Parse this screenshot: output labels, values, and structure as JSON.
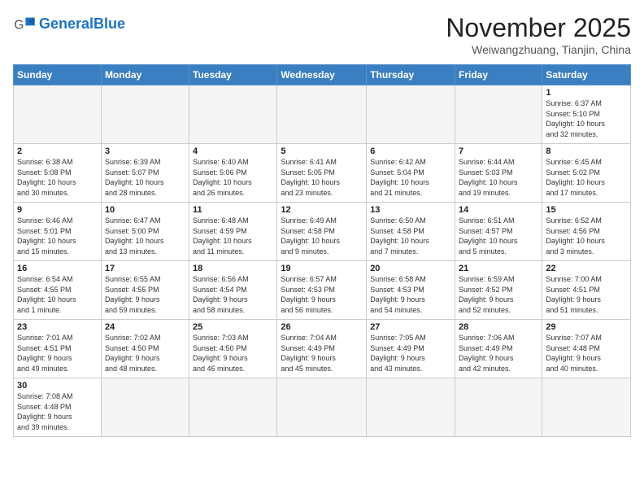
{
  "header": {
    "logo_general": "General",
    "logo_blue": "Blue",
    "month_title": "November 2025",
    "location": "Weiwangzhuang, Tianjin, China"
  },
  "weekdays": [
    "Sunday",
    "Monday",
    "Tuesday",
    "Wednesday",
    "Thursday",
    "Friday",
    "Saturday"
  ],
  "days": [
    {
      "num": "",
      "info": ""
    },
    {
      "num": "",
      "info": ""
    },
    {
      "num": "",
      "info": ""
    },
    {
      "num": "",
      "info": ""
    },
    {
      "num": "",
      "info": ""
    },
    {
      "num": "",
      "info": ""
    },
    {
      "num": "1",
      "info": "Sunrise: 6:37 AM\nSunset: 5:10 PM\nDaylight: 10 hours\nand 32 minutes."
    },
    {
      "num": "2",
      "info": "Sunrise: 6:38 AM\nSunset: 5:08 PM\nDaylight: 10 hours\nand 30 minutes."
    },
    {
      "num": "3",
      "info": "Sunrise: 6:39 AM\nSunset: 5:07 PM\nDaylight: 10 hours\nand 28 minutes."
    },
    {
      "num": "4",
      "info": "Sunrise: 6:40 AM\nSunset: 5:06 PM\nDaylight: 10 hours\nand 26 minutes."
    },
    {
      "num": "5",
      "info": "Sunrise: 6:41 AM\nSunset: 5:05 PM\nDaylight: 10 hours\nand 23 minutes."
    },
    {
      "num": "6",
      "info": "Sunrise: 6:42 AM\nSunset: 5:04 PM\nDaylight: 10 hours\nand 21 minutes."
    },
    {
      "num": "7",
      "info": "Sunrise: 6:44 AM\nSunset: 5:03 PM\nDaylight: 10 hours\nand 19 minutes."
    },
    {
      "num": "8",
      "info": "Sunrise: 6:45 AM\nSunset: 5:02 PM\nDaylight: 10 hours\nand 17 minutes."
    },
    {
      "num": "9",
      "info": "Sunrise: 6:46 AM\nSunset: 5:01 PM\nDaylight: 10 hours\nand 15 minutes."
    },
    {
      "num": "10",
      "info": "Sunrise: 6:47 AM\nSunset: 5:00 PM\nDaylight: 10 hours\nand 13 minutes."
    },
    {
      "num": "11",
      "info": "Sunrise: 6:48 AM\nSunset: 4:59 PM\nDaylight: 10 hours\nand 11 minutes."
    },
    {
      "num": "12",
      "info": "Sunrise: 6:49 AM\nSunset: 4:58 PM\nDaylight: 10 hours\nand 9 minutes."
    },
    {
      "num": "13",
      "info": "Sunrise: 6:50 AM\nSunset: 4:58 PM\nDaylight: 10 hours\nand 7 minutes."
    },
    {
      "num": "14",
      "info": "Sunrise: 6:51 AM\nSunset: 4:57 PM\nDaylight: 10 hours\nand 5 minutes."
    },
    {
      "num": "15",
      "info": "Sunrise: 6:52 AM\nSunset: 4:56 PM\nDaylight: 10 hours\nand 3 minutes."
    },
    {
      "num": "16",
      "info": "Sunrise: 6:54 AM\nSunset: 4:55 PM\nDaylight: 10 hours\nand 1 minute."
    },
    {
      "num": "17",
      "info": "Sunrise: 6:55 AM\nSunset: 4:55 PM\nDaylight: 9 hours\nand 59 minutes."
    },
    {
      "num": "18",
      "info": "Sunrise: 6:56 AM\nSunset: 4:54 PM\nDaylight: 9 hours\nand 58 minutes."
    },
    {
      "num": "19",
      "info": "Sunrise: 6:57 AM\nSunset: 4:53 PM\nDaylight: 9 hours\nand 56 minutes."
    },
    {
      "num": "20",
      "info": "Sunrise: 6:58 AM\nSunset: 4:53 PM\nDaylight: 9 hours\nand 54 minutes."
    },
    {
      "num": "21",
      "info": "Sunrise: 6:59 AM\nSunset: 4:52 PM\nDaylight: 9 hours\nand 52 minutes."
    },
    {
      "num": "22",
      "info": "Sunrise: 7:00 AM\nSunset: 4:51 PM\nDaylight: 9 hours\nand 51 minutes."
    },
    {
      "num": "23",
      "info": "Sunrise: 7:01 AM\nSunset: 4:51 PM\nDaylight: 9 hours\nand 49 minutes."
    },
    {
      "num": "24",
      "info": "Sunrise: 7:02 AM\nSunset: 4:50 PM\nDaylight: 9 hours\nand 48 minutes."
    },
    {
      "num": "25",
      "info": "Sunrise: 7:03 AM\nSunset: 4:50 PM\nDaylight: 9 hours\nand 46 minutes."
    },
    {
      "num": "26",
      "info": "Sunrise: 7:04 AM\nSunset: 4:49 PM\nDaylight: 9 hours\nand 45 minutes."
    },
    {
      "num": "27",
      "info": "Sunrise: 7:05 AM\nSunset: 4:49 PM\nDaylight: 9 hours\nand 43 minutes."
    },
    {
      "num": "28",
      "info": "Sunrise: 7:06 AM\nSunset: 4:49 PM\nDaylight: 9 hours\nand 42 minutes."
    },
    {
      "num": "29",
      "info": "Sunrise: 7:07 AM\nSunset: 4:48 PM\nDaylight: 9 hours\nand 40 minutes."
    },
    {
      "num": "30",
      "info": "Sunrise: 7:08 AM\nSunset: 4:48 PM\nDaylight: 9 hours\nand 39 minutes."
    },
    {
      "num": "",
      "info": ""
    },
    {
      "num": "",
      "info": ""
    },
    {
      "num": "",
      "info": ""
    },
    {
      "num": "",
      "info": ""
    },
    {
      "num": "",
      "info": ""
    },
    {
      "num": "",
      "info": ""
    }
  ]
}
